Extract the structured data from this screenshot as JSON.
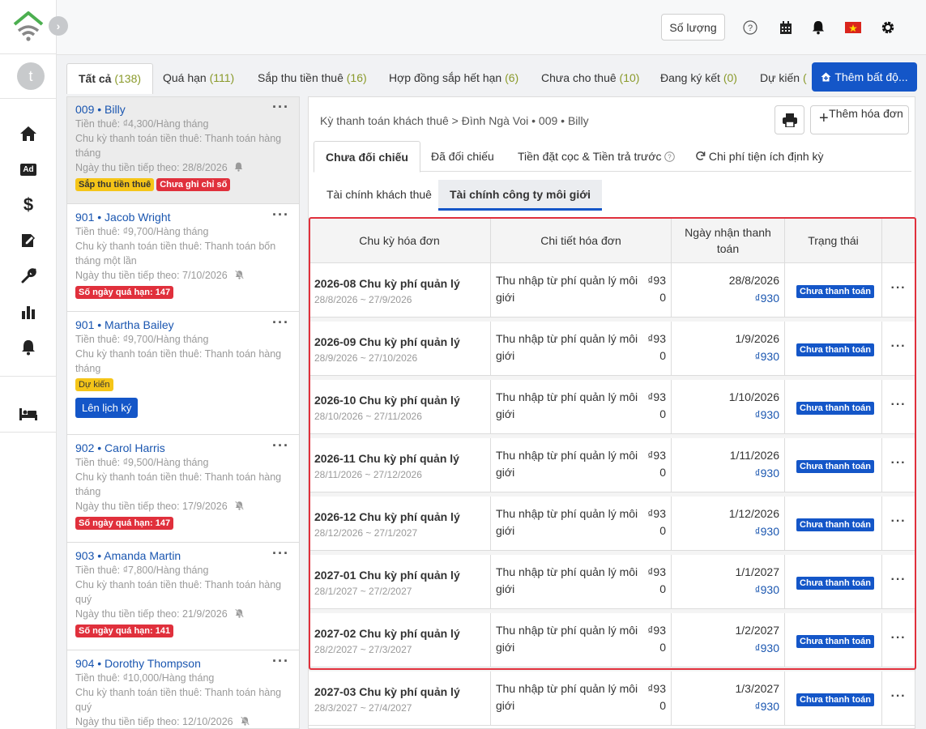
{
  "nav": {
    "expand_icon": "chevron-right-icon",
    "avatar_letter": "t",
    "items": [
      "home-icon",
      "ad-icon",
      "dollar-icon",
      "contract-edit-icon",
      "wrench-icon",
      "bar-chart-icon",
      "bell-icon",
      "bed-icon"
    ],
    "ad_label": "Ad",
    "dollar_label": "$"
  },
  "topbar": {
    "quantity_label": "Số lượng",
    "icons": [
      "help-icon",
      "calendar-icon",
      "bell-icon",
      "vietnam-flag-icon",
      "settings-icon"
    ]
  },
  "filter_tabs": [
    {
      "label": "Tất cả",
      "count": "(138)"
    },
    {
      "label": "Quá hạn",
      "count": "(111)"
    },
    {
      "label": "Sắp thu tiền thuê",
      "count": "(16)"
    },
    {
      "label": "Hợp đồng sắp hết hạn",
      "count": "(6)"
    },
    {
      "label": "Chưa cho thuê",
      "count": "(10)"
    },
    {
      "label": "Đang ký kết",
      "count": "(0)"
    },
    {
      "label": "Dự kiến",
      "count": "("
    }
  ],
  "add_property_label": "Thêm bất độ...",
  "tenants": [
    {
      "unit": "009",
      "name": "Billy",
      "rent": "Tiền thuê: ₫4,300/Hàng tháng",
      "cycle": "Chu kỳ thanh toán tiền thuê: Thanh toán hàng tháng",
      "next": "Ngày thu tiền tiếp theo:  28/8/2026",
      "badges": [
        "Sắp thu tiền thuê",
        "Chưa ghi chỉ số"
      ]
    },
    {
      "unit": "901",
      "name": "Jacob Wright",
      "rent": "Tiền thuê: ₫9,700/Hàng tháng",
      "cycle": "Chu kỳ thanh toán tiền thuê: Thanh toán bốn tháng một lần",
      "next": "Ngày thu tiền tiếp theo:  7/10/2026",
      "badges": [
        "Số ngày quá hạn: 147"
      ]
    },
    {
      "unit": "901",
      "name": "Martha Bailey",
      "rent": "Tiền thuê: ₫9,700/Hàng tháng",
      "cycle": "Chu kỳ thanh toán tiền thuê: Thanh toán hàng tháng",
      "badges": [
        "Dự kiến"
      ],
      "button": "Lên lịch ký"
    },
    {
      "unit": "902",
      "name": "Carol Harris",
      "rent": "Tiền thuê: ₫9,500/Hàng tháng",
      "cycle": "Chu kỳ thanh toán tiền thuê: Thanh toán hàng tháng",
      "next": "Ngày thu tiền tiếp theo:  17/9/2026",
      "badges": [
        "Số ngày quá hạn: 147"
      ]
    },
    {
      "unit": "903",
      "name": "Amanda Martin",
      "rent": "Tiền thuê: ₫7,800/Hàng tháng",
      "cycle": "Chu kỳ thanh toán tiền thuê: Thanh toán hàng quý",
      "next": "Ngày thu tiền tiếp theo:  21/9/2026",
      "badges": [
        "Số ngày quá hạn: 141"
      ]
    },
    {
      "unit": "904",
      "name": "Dorothy Thompson",
      "rent": "Tiền thuê: ₫10,000/Hàng tháng",
      "cycle": "Chu kỳ thanh toán tiền thuê: Thanh toán hàng quý",
      "next": "Ngày thu tiền tiếp theo:  12/10/2026",
      "badges": []
    }
  ],
  "main": {
    "breadcrumb": "Kỳ thanh toán khách thuê  >   Đình Ngà Voi • 009 • Billy",
    "print_icon": "printer-icon",
    "add_invoice_label": "Thêm hóa đơn",
    "sub_tabs": [
      "Chưa đối chiếu",
      "Đã đối chiếu",
      "Tiền đặt cọc & Tiền trả trước",
      "Chi phí tiện ích định kỳ"
    ],
    "finance_tabs": [
      "Tài chính khách thuê",
      "Tài chính công ty môi giới"
    ],
    "table": {
      "headers": [
        "Chu kỳ hóa đơn",
        "Chi tiết hóa đơn",
        "Ngày nhận thanh toán",
        "Trạng thái",
        ""
      ],
      "rows": [
        {
          "cycle": "2026-08 Chu kỳ phí quản lý",
          "range": "28/8/2026 ~ 27/9/2026",
          "detail": "Thu nhập từ phí quản lý môi giới",
          "amount": "₫930",
          "date": "28/8/2026",
          "paid": "₫930",
          "status": "Chưa thanh toán"
        },
        {
          "cycle": "2026-09 Chu kỳ phí quản lý",
          "range": "28/9/2026 ~ 27/10/2026",
          "detail": "Thu nhập từ phí quản lý môi giới",
          "amount": "₫930",
          "date": "1/9/2026",
          "paid": "₫930",
          "status": "Chưa thanh toán"
        },
        {
          "cycle": "2026-10 Chu kỳ phí quản lý",
          "range": "28/10/2026 ~ 27/11/2026",
          "detail": "Thu nhập từ phí quản lý môi giới",
          "amount": "₫930",
          "date": "1/10/2026",
          "paid": "₫930",
          "status": "Chưa thanh toán"
        },
        {
          "cycle": "2026-11 Chu kỳ phí quản lý",
          "range": "28/11/2026 ~ 27/12/2026",
          "detail": "Thu nhập từ phí quản lý môi giới",
          "amount": "₫930",
          "date": "1/11/2026",
          "paid": "₫930",
          "status": "Chưa thanh toán"
        },
        {
          "cycle": "2026-12 Chu kỳ phí quản lý",
          "range": "28/12/2026 ~ 27/1/2027",
          "detail": "Thu nhập từ phí quản lý môi giới",
          "amount": "₫930",
          "date": "1/12/2026",
          "paid": "₫930",
          "status": "Chưa thanh toán"
        },
        {
          "cycle": "2027-01 Chu kỳ phí quản lý",
          "range": "28/1/2027 ~ 27/2/2027",
          "detail": "Thu nhập từ phí quản lý môi giới",
          "amount": "₫930",
          "date": "1/1/2027",
          "paid": "₫930",
          "status": "Chưa thanh toán"
        },
        {
          "cycle": "2027-02 Chu kỳ phí quản lý",
          "range": "28/2/2027 ~ 27/3/2027",
          "detail": "Thu nhập từ phí quản lý môi giới",
          "amount": "₫930",
          "date": "1/2/2027",
          "paid": "₫930",
          "status": "Chưa thanh toán"
        },
        {
          "cycle": "2027-03 Chu kỳ phí quản lý",
          "range": "28/3/2027 ~ 27/4/2027",
          "detail": "Thu nhập từ phí quản lý môi giới",
          "amount": "₫930",
          "date": "1/3/2027",
          "paid": "₫930",
          "status": "Chưa thanh toán"
        }
      ]
    }
  },
  "colors": {
    "primary": "#1456c8",
    "link": "#1a56b0",
    "danger": "#e0303c",
    "warning": "#f5c518",
    "count": "#8a9a2a"
  }
}
